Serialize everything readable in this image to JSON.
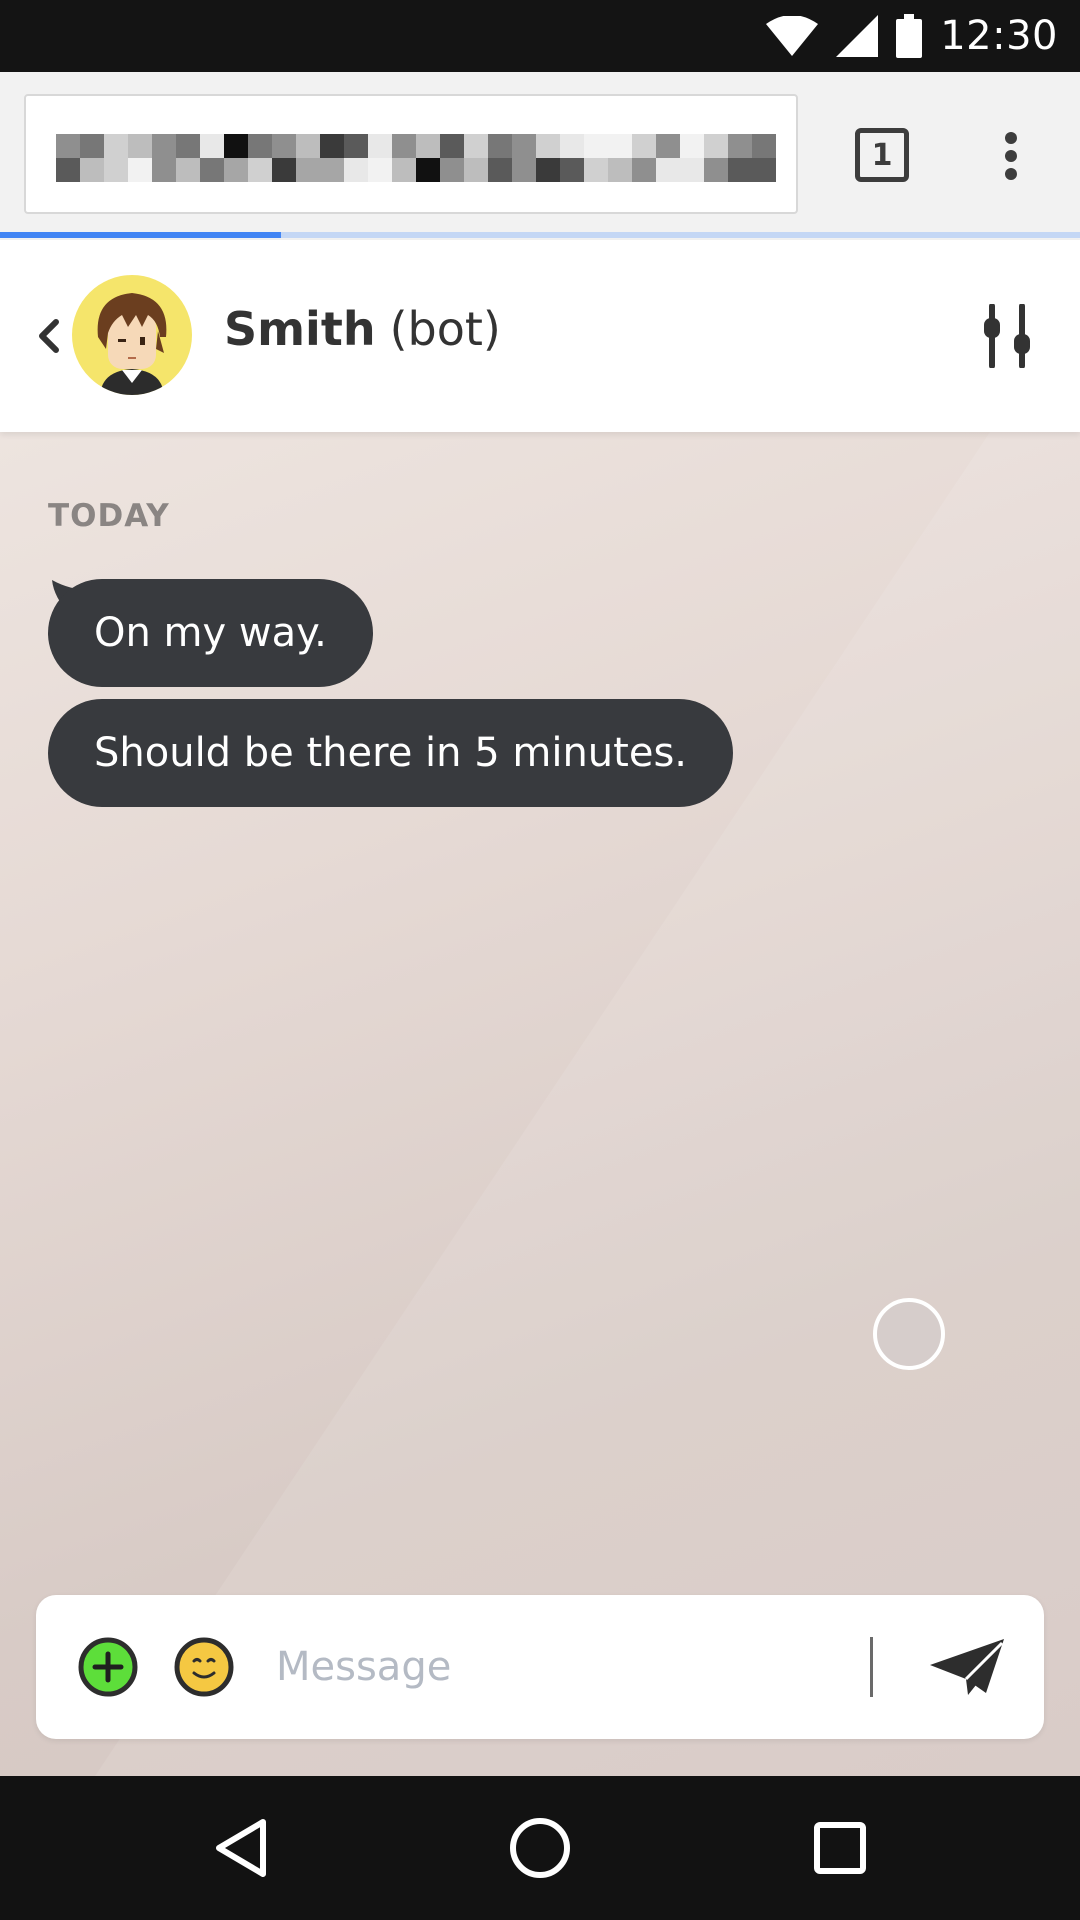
{
  "status_bar": {
    "time": "12:30",
    "icons": [
      "wifi-icon",
      "cell-signal-icon",
      "battery-icon"
    ]
  },
  "browser": {
    "url_obscured": true,
    "tab_count": "1",
    "page_load_progress": 0.26,
    "icons": [
      "tab-switcher-icon",
      "more-vert-icon"
    ],
    "accent_color": "#4285f4"
  },
  "chat_header": {
    "name": "Smith",
    "tag": "(bot)",
    "icons": [
      "back-chevron-icon",
      "avatar-icon",
      "sliders-icon"
    ]
  },
  "chat": {
    "day_label": "TODAY",
    "messages": [
      {
        "text": "On my way."
      },
      {
        "text": "Should be there in 5 minutes."
      }
    ],
    "bubble_color": "#383a3e"
  },
  "composer": {
    "placeholder": "Message",
    "value": "",
    "icons": [
      "add-icon",
      "emoji-icon",
      "send-icon"
    ],
    "add_color": "#5dde3a",
    "emoji_color": "#f5c842"
  },
  "nav_bar": {
    "icons": [
      "back-triangle-icon",
      "home-circle-icon",
      "recents-square-icon"
    ]
  }
}
